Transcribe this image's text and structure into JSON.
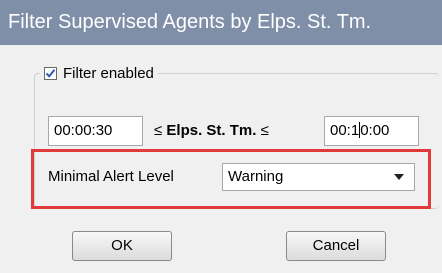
{
  "window": {
    "title": "Filter Supervised Agents by Elps. St. Tm."
  },
  "filter": {
    "enabled_label": "Filter enabled",
    "enabled": true
  },
  "range": {
    "min_value": "00:00:30",
    "label_prefix": "≤",
    "label_text": "Elps. St. Tm.",
    "label_suffix": "≤",
    "max_value_before_cursor": "00:1",
    "max_value_after_cursor": "0:00"
  },
  "alert": {
    "label": "Minimal Alert Level",
    "selected": "Warning"
  },
  "buttons": {
    "ok_label": "OK",
    "cancel_label": "Cancel"
  },
  "colors": {
    "titlebar": "#7f8fa8",
    "highlight": "#e03a3a",
    "checkmark": "#2a5db0"
  }
}
